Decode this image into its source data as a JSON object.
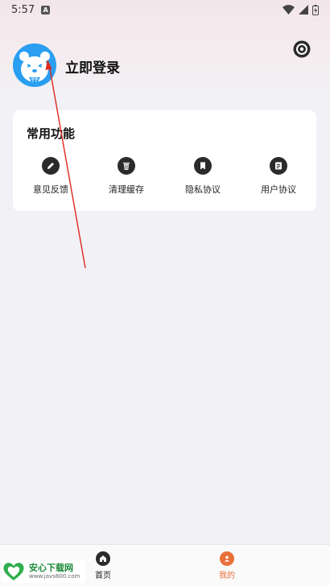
{
  "status_bar": {
    "time": "5:57",
    "notification_letter": "A"
  },
  "header": {
    "login_label": "立即登录"
  },
  "common_functions": {
    "title": "常用功能",
    "items": [
      {
        "label": "意见反馈",
        "icon": "pencil-icon"
      },
      {
        "label": "清理缓存",
        "icon": "trash-icon"
      },
      {
        "label": "隐私协议",
        "icon": "bookmark-icon"
      },
      {
        "label": "用户协议",
        "icon": "document-icon"
      }
    ]
  },
  "bottom_nav": {
    "items": [
      {
        "label": "首页",
        "icon": "home-icon",
        "active": false
      },
      {
        "label": "我的",
        "icon": "profile-icon",
        "active": true
      }
    ]
  },
  "watermark": {
    "title": "安心下载网",
    "url": "www.javs800.com"
  },
  "colors": {
    "accent": "#e8713a",
    "avatar_bg": "#2a9ef0",
    "annotation": "#e0281e"
  }
}
